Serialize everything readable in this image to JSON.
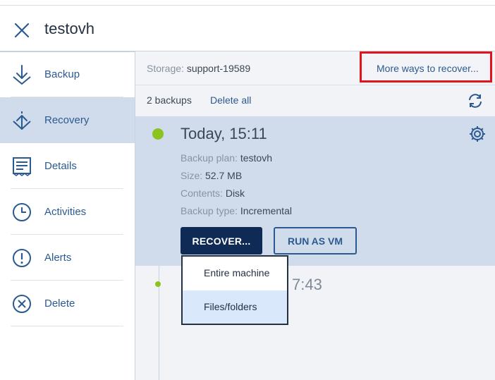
{
  "header": {
    "title": "testovh",
    "close_icon": "close-icon"
  },
  "sidebar": {
    "items": [
      {
        "label": "Backup",
        "icon": "backup-icon",
        "active": false
      },
      {
        "label": "Recovery",
        "icon": "recovery-icon",
        "active": true
      },
      {
        "label": "Details",
        "icon": "details-icon",
        "active": false
      },
      {
        "label": "Activities",
        "icon": "clock-icon",
        "active": false
      },
      {
        "label": "Alerts",
        "icon": "alert-icon",
        "active": false
      },
      {
        "label": "Delete",
        "icon": "delete-icon",
        "active": false
      }
    ]
  },
  "storage": {
    "label": "Storage:",
    "value": "support-19589",
    "more_ways": "More ways to recover..."
  },
  "backups": {
    "count_label": "2 backups",
    "delete_all": "Delete all"
  },
  "backup_item": {
    "time": "Today, 15:11",
    "plan_label": "Backup plan:",
    "plan_value": "testovh",
    "size_label": "Size:",
    "size_value": "52.7 MB",
    "contents_label": "Contents:",
    "contents_value": "Disk",
    "type_label": "Backup type:",
    "type_value": "Incremental",
    "recover_button": "RECOVER...",
    "run_vm_button": "RUN AS VM"
  },
  "older_backup": {
    "time_partial": "7:43"
  },
  "recover_menu": {
    "items": [
      "Entire machine",
      "Files/folders"
    ],
    "highlighted_index": 1
  },
  "colors": {
    "accent": "#2b5a91",
    "active_bg": "#d0dcec",
    "primary_button": "#0f2a55",
    "status_ok": "#8bc31f",
    "highlight_border": "#e2131b"
  }
}
